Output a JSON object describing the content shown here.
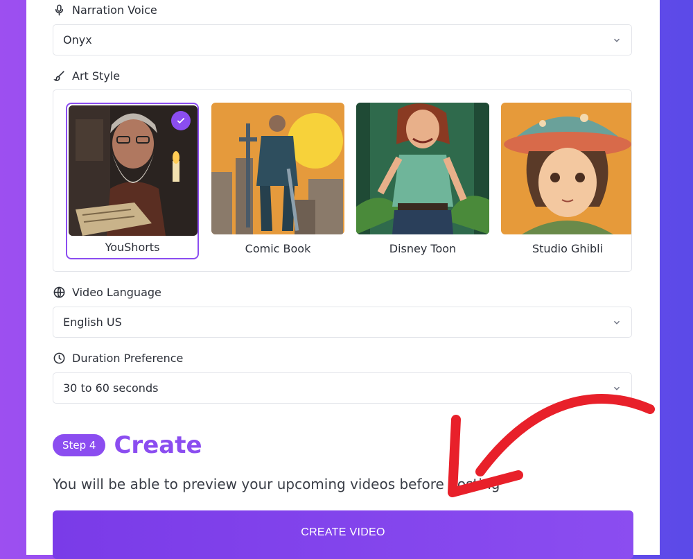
{
  "narration": {
    "label": "Narration Voice",
    "value": "Onyx",
    "icon": "microphone-icon"
  },
  "art_style": {
    "label": "Art Style",
    "icon": "brush-icon",
    "selected": "YouShorts",
    "options": [
      {
        "label": "YouShorts"
      },
      {
        "label": "Comic Book"
      },
      {
        "label": "Disney Toon"
      },
      {
        "label": "Studio Ghibli"
      }
    ]
  },
  "language": {
    "label": "Video Language",
    "value": "English US",
    "icon": "globe-icon"
  },
  "duration": {
    "label": "Duration Preference",
    "value": "30 to 60 seconds",
    "icon": "clock-icon"
  },
  "step": {
    "badge": "Step 4",
    "title": "Create"
  },
  "subtitle": "You will be able to preview your upcoming videos before posting",
  "cta": {
    "label": "CREATE VIDEO"
  },
  "colors": {
    "accent": "#8B4DF0",
    "annotation_arrow": "#E8202A",
    "border": "#E3E5EA"
  }
}
